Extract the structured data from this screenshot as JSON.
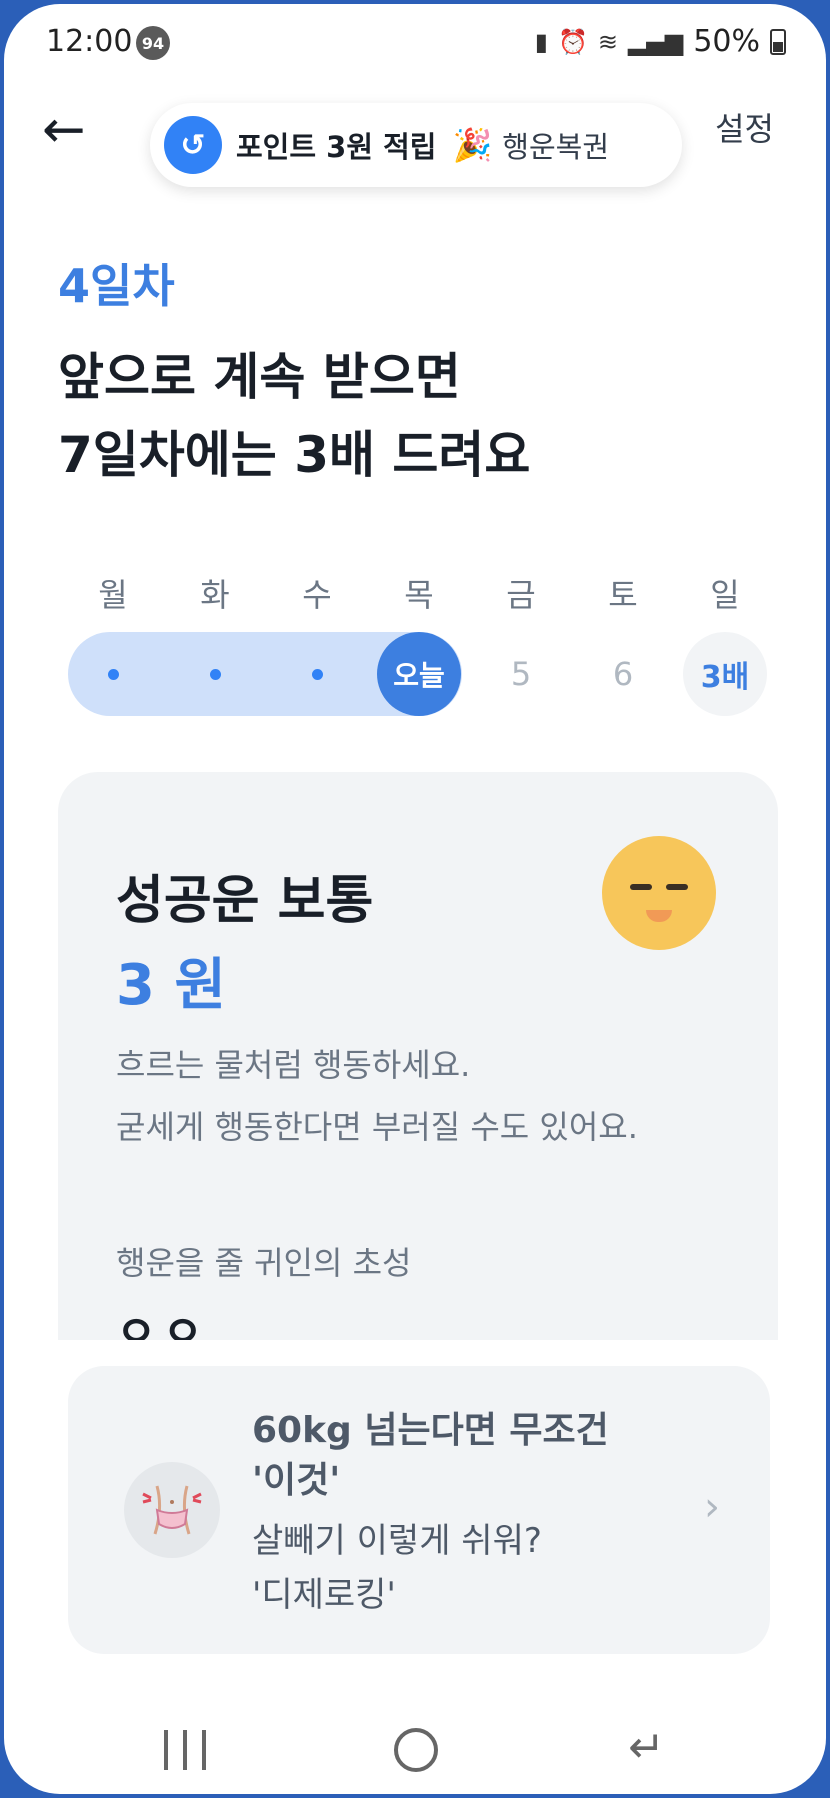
{
  "status_bar": {
    "time": "12:00",
    "notification_count": "94",
    "battery": "50%"
  },
  "header": {
    "back_icon": "arrow-left-icon",
    "banner_points": "포인트 3원 적립",
    "banner_lottery": "행운복권",
    "settings": "설정"
  },
  "streak": {
    "day_label": "4일차",
    "headline_line1": "앞으로 계속 받으면",
    "headline_line2": "7일차에는 3배 드려요",
    "weekdays": [
      "월",
      "화",
      "수",
      "목",
      "금",
      "토",
      "일"
    ],
    "today_label": "오늘",
    "future_days": [
      "5",
      "6"
    ],
    "bonus_label": "3배"
  },
  "fortune_card": {
    "title": "성공운 보통",
    "amount": "3 원",
    "description_line1": "흐르는 물처럼 행동하세요.",
    "description_line2": "굳세게 행동한다면 부러질 수도 있어요.",
    "benefactor_label": "행운을 줄 귀인의 초성",
    "benefactor_initials": "ㅇㅇ",
    "face_icon": "sleepy-face-icon"
  },
  "ad_card": {
    "headline_line1": "60kg 넘는다면 무조건",
    "headline_line2": "'이것'",
    "body_line1": "살빼기 이렇게 쉬워?",
    "body_line2": "'디제로킹'",
    "chevron": "›"
  },
  "colors": {
    "accent": "#3d7fe0",
    "track": "#cfe0fa",
    "card_bg": "#f2f4f6",
    "frame": "#2b5fb8"
  }
}
